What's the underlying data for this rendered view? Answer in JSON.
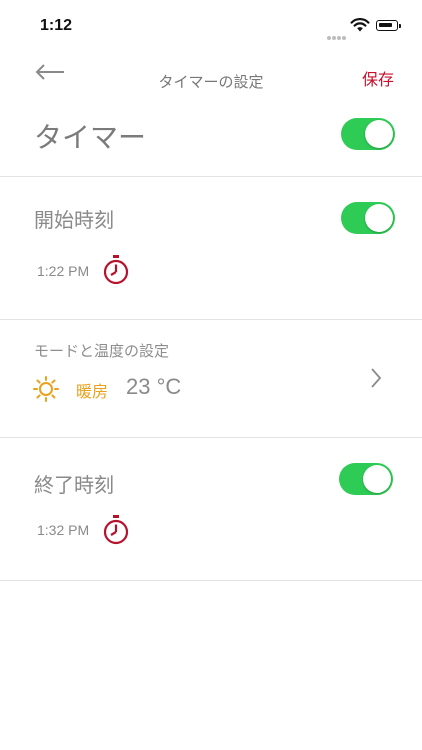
{
  "status_bar": {
    "time": "1:12"
  },
  "nav": {
    "title": "タイマーの設定",
    "save_label": "保存"
  },
  "timer": {
    "label": "タイマー",
    "enabled": true
  },
  "start": {
    "label": "開始時刻",
    "enabled": true,
    "time": "1:22 PM"
  },
  "mode": {
    "label": "モードと温度の設定",
    "mode_name": "暖房",
    "temperature": "23 °C"
  },
  "end": {
    "label": "終了時刻",
    "enabled": true,
    "time": "1:32 PM"
  },
  "colors": {
    "accent": "#c8102e",
    "toggle_on": "#2ecc55",
    "heat": "#e9a21c"
  },
  "icons": [
    "back-arrow-icon",
    "clock-icon",
    "sun-icon",
    "chevron-right-icon",
    "wifi-icon",
    "battery-icon"
  ]
}
